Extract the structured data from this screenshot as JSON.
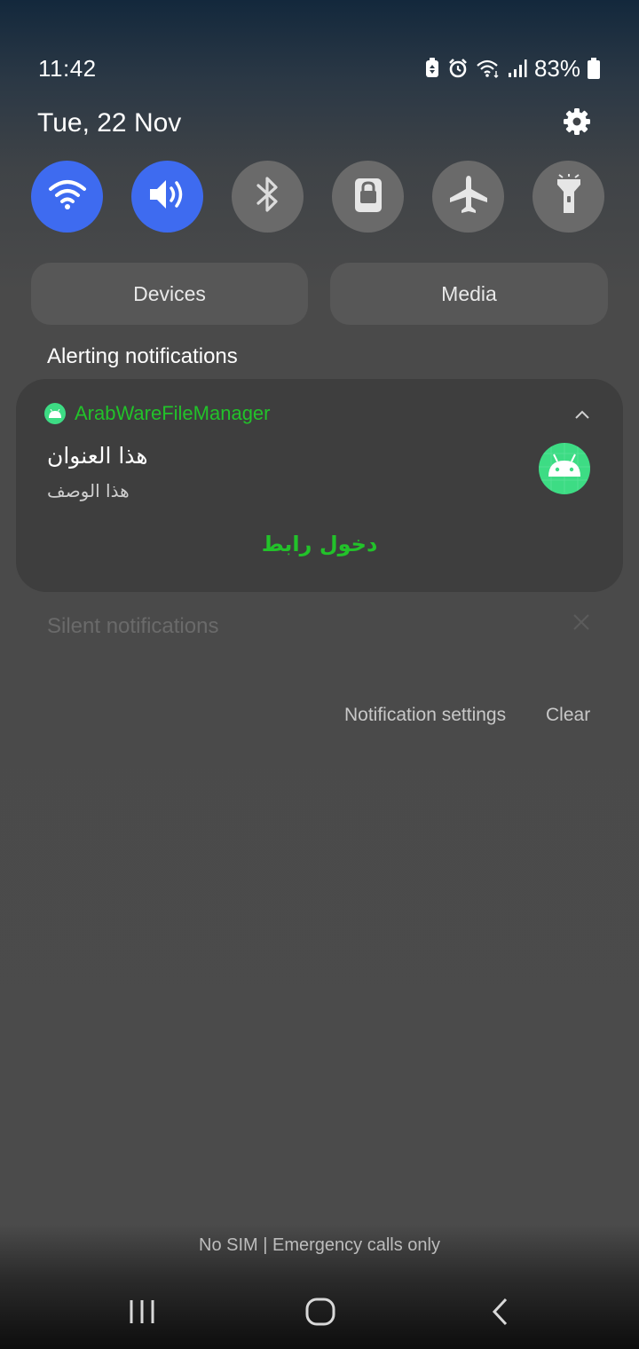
{
  "status_bar": {
    "time": "11:42",
    "battery_percent": "83%",
    "icons": [
      "battery-saver-icon",
      "alarm-icon",
      "wifi-icon",
      "signal-icon",
      "battery-icon"
    ]
  },
  "header": {
    "date": "Tue, 22 Nov",
    "settings_icon": "gear-icon"
  },
  "quick_settings": {
    "tiles": [
      {
        "name": "wifi",
        "icon": "wifi-icon",
        "active": true
      },
      {
        "name": "sound",
        "icon": "volume-icon",
        "active": true
      },
      {
        "name": "bluetooth",
        "icon": "bluetooth-icon",
        "active": false
      },
      {
        "name": "rotation-lock",
        "icon": "lock-icon",
        "active": false
      },
      {
        "name": "airplane-mode",
        "icon": "airplane-icon",
        "active": false
      },
      {
        "name": "flashlight",
        "icon": "flashlight-icon",
        "active": false
      }
    ],
    "active_color": "#3e6bf0",
    "inactive_color": "#6a6a6a"
  },
  "panels": {
    "devices_label": "Devices",
    "media_label": "Media"
  },
  "alerting": {
    "section_title": "Alerting notifications",
    "notification": {
      "app_name": "ArabWareFileManager",
      "title": "هذا العنوان",
      "description": "هذا الوصف",
      "action_label": "دخول رابط",
      "accent_color": "#22c22a",
      "icon": "android-icon"
    }
  },
  "silent": {
    "section_title": "Silent notifications"
  },
  "footer": {
    "notification_settings_label": "Notification settings",
    "clear_label": "Clear",
    "carrier_text": "No SIM | Emergency calls only"
  },
  "nav_bar": {
    "buttons": [
      "recents-icon",
      "home-icon",
      "back-icon"
    ]
  }
}
